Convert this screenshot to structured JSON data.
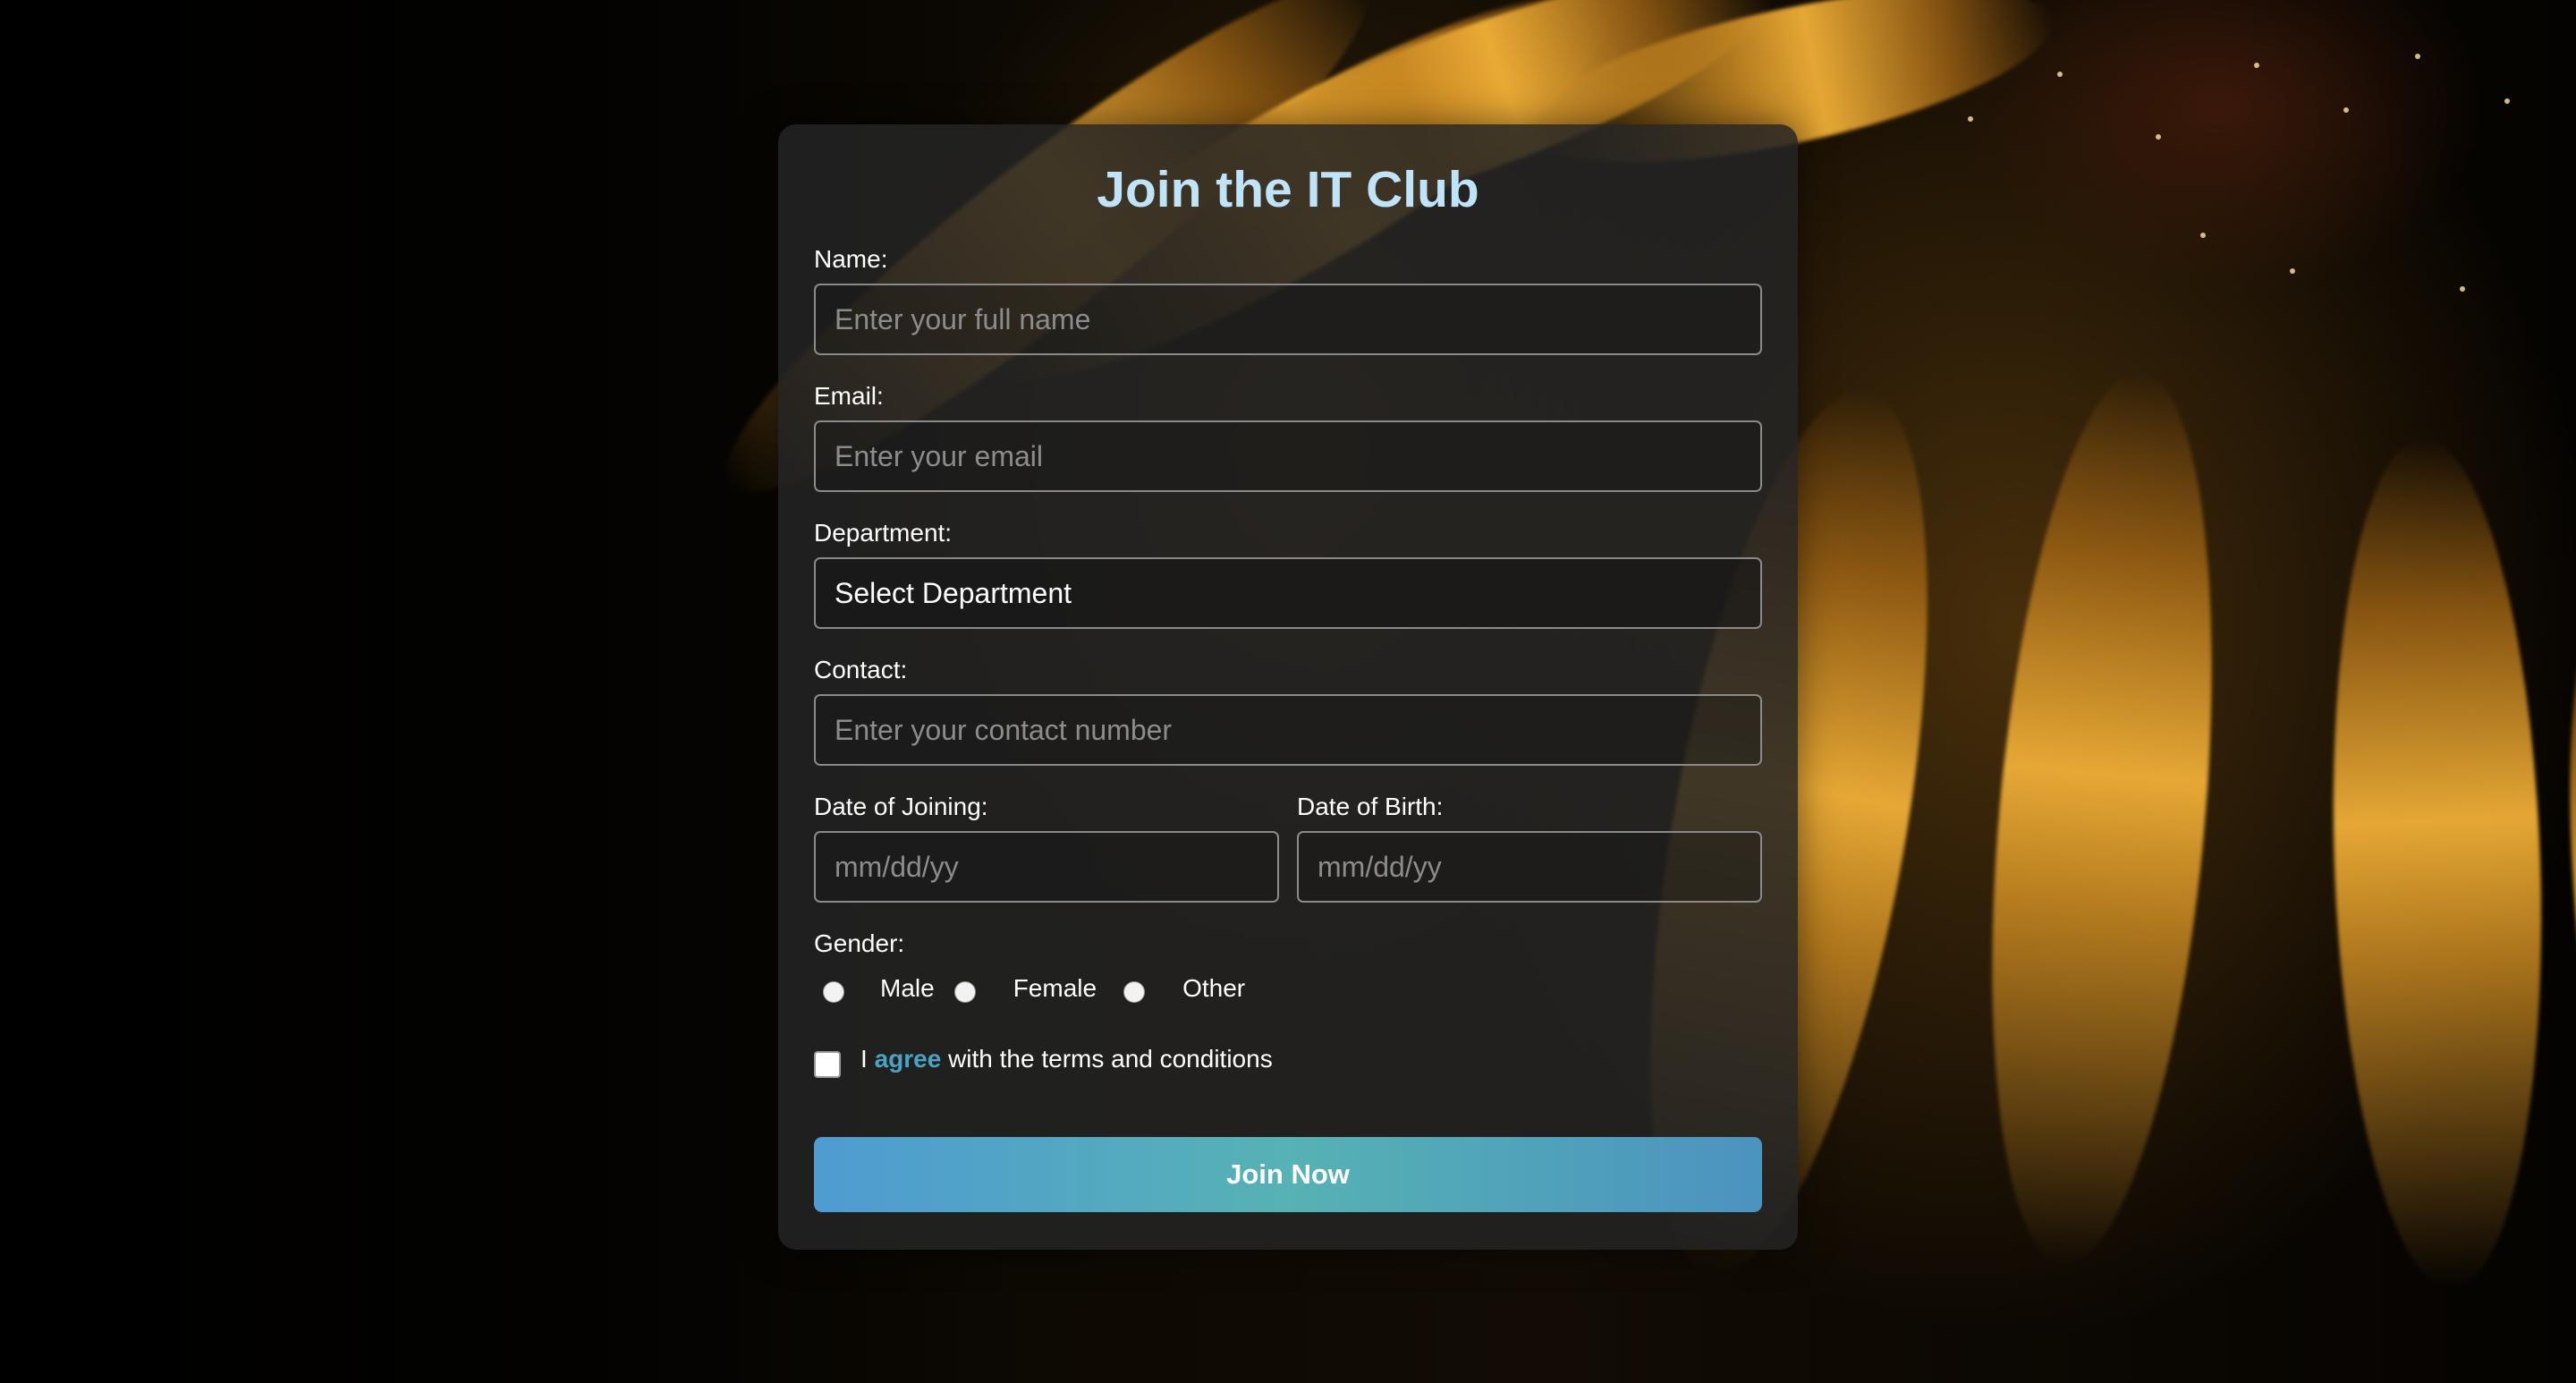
{
  "form": {
    "title": "Join the IT Club",
    "name": {
      "label": "Name:",
      "placeholder": "Enter your full name"
    },
    "email": {
      "label": "Email:",
      "placeholder": "Enter your email"
    },
    "department": {
      "label": "Department:",
      "selected": "Select Department"
    },
    "contact": {
      "label": "Contact:",
      "placeholder": "Enter your contact number"
    },
    "date_of_joining": {
      "label": "Date of Joining:",
      "placeholder": "mm/dd/yy"
    },
    "date_of_birth": {
      "label": "Date of Birth:",
      "placeholder": "mm/dd/yy"
    },
    "gender": {
      "label": "Gender:",
      "options": [
        "Male",
        "Female",
        "Other"
      ]
    },
    "terms": {
      "prefix": "I",
      "link": "agree",
      "suffix": "with the terms and conditions"
    },
    "submit_label": "Join Now"
  },
  "colors": {
    "title": "#bfe3f8",
    "link": "#4aa3c4",
    "button_start": "#4f9bd2",
    "button_mid": "#56b2b4"
  }
}
